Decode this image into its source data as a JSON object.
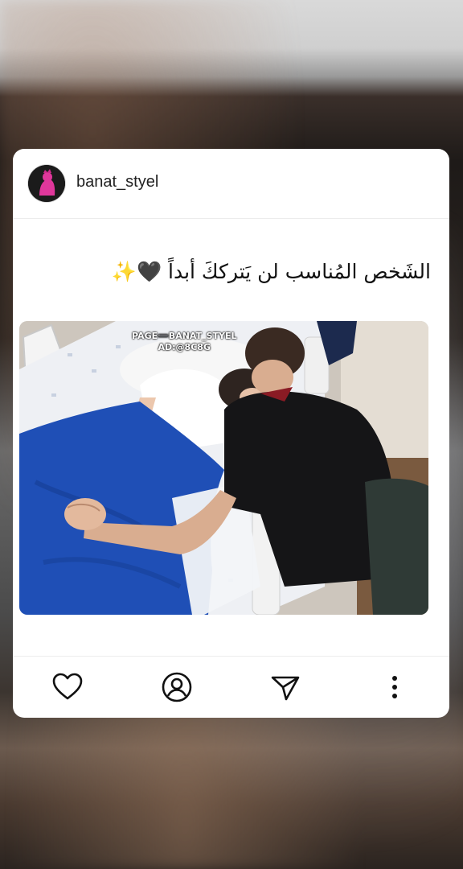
{
  "post": {
    "username": "banat_styel",
    "caption": "الشَخص المُناسب لن يَترككَ أبداً 🖤✨",
    "watermark_line1": "PAGE➖BANAT_STYEL",
    "watermark_line2": "AD:@8C8G"
  },
  "actions": {
    "icons": [
      "heart-icon",
      "profile-icon",
      "send-icon",
      "more-vertical-icon"
    ]
  },
  "colors": {
    "card": "#ffffff",
    "text": "#111111",
    "blanket": "#1f4fb6",
    "shirt": "#151517"
  }
}
